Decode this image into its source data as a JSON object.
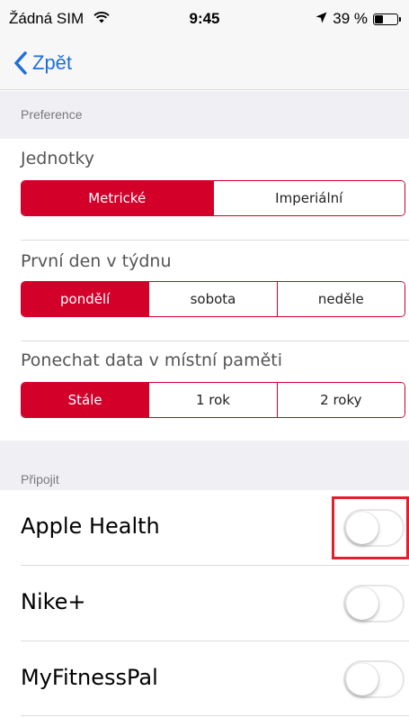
{
  "status_bar": {
    "carrier": "Žádná SIM",
    "time": "9:45",
    "battery": "39 %",
    "battery_level": 0.39
  },
  "nav": {
    "back_label": "Zpět"
  },
  "preferences": {
    "header": "Preference",
    "units": {
      "label": "Jednotky",
      "options": [
        "Metrické",
        "Imperiální"
      ],
      "selected": "Metrické"
    },
    "first_day": {
      "label": "První den v týdnu",
      "options": [
        "pondělí",
        "sobota",
        "neděle"
      ],
      "selected": "pondělí"
    },
    "keep_data": {
      "label": "Ponechat data v místní paměti",
      "options": [
        "Stále",
        "1 rok",
        "2 roky"
      ],
      "selected": "Stále"
    }
  },
  "connect": {
    "header": "Připojit",
    "items": [
      {
        "label": "Apple Health",
        "on": false
      },
      {
        "label": "Nike+",
        "on": false
      },
      {
        "label": "MyFitnessPal",
        "on": false
      }
    ]
  },
  "colors": {
    "accent": "#d3002a",
    "link": "#1e6fd9",
    "highlight": "#e0202a"
  }
}
